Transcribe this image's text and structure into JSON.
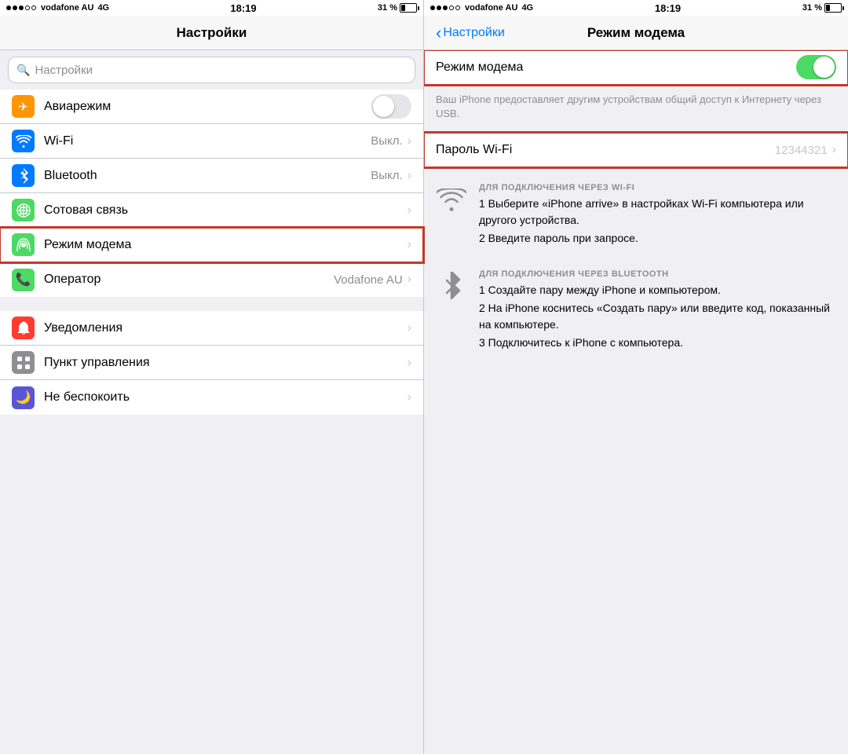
{
  "left": {
    "status_bar": {
      "carrier": "vodafone AU",
      "network": "4G",
      "time": "18:19",
      "battery_pct": "31 %"
    },
    "nav_title": "Настройки",
    "search_placeholder": "Настройки",
    "settings_items": [
      {
        "id": "airplane",
        "label": "Авиарежим",
        "value": "",
        "has_toggle": true,
        "toggle_on": false,
        "icon_bg": "#ff9500",
        "icon": "✈"
      },
      {
        "id": "wifi",
        "label": "Wi-Fi",
        "value": "Выкл.",
        "has_toggle": false,
        "icon_bg": "#007aff",
        "icon": "wifi"
      },
      {
        "id": "bluetooth",
        "label": "Bluetooth",
        "value": "Выкл.",
        "has_toggle": false,
        "icon_bg": "#007aff",
        "icon": "bt"
      },
      {
        "id": "cellular",
        "label": "Сотовая связь",
        "value": "",
        "has_toggle": false,
        "icon_bg": "#4cd964",
        "icon": "cellular"
      },
      {
        "id": "hotspot",
        "label": "Режим модема",
        "value": "",
        "has_toggle": false,
        "icon_bg": "#4cd964",
        "icon": "hotspot",
        "highlight": true
      },
      {
        "id": "operator",
        "label": "Оператор",
        "value": "Vodafone AU",
        "has_toggle": false,
        "icon_bg": "#4cd964",
        "icon": "phone"
      }
    ],
    "settings_items2": [
      {
        "id": "notifications",
        "label": "Уведомления",
        "value": "",
        "has_toggle": false,
        "icon_bg": "#ff3b30",
        "icon": "notif"
      },
      {
        "id": "control",
        "label": "Пункт управления",
        "value": "",
        "has_toggle": false,
        "icon_bg": "#8e8e93",
        "icon": "ctrl"
      },
      {
        "id": "dnd",
        "label": "Не беспокоить",
        "value": "",
        "has_toggle": false,
        "icon_bg": "#5856d6",
        "icon": "moon"
      }
    ]
  },
  "right": {
    "status_bar": {
      "carrier": "vodafone AU",
      "network": "4G",
      "time": "18:19",
      "battery_pct": "31 %"
    },
    "back_label": "Настройки",
    "nav_title": "Режим модема",
    "modem_toggle_label": "Режим модема",
    "modem_toggle_on": true,
    "info_text": "Ваш iPhone предоставляет другим устройствам общий доступ к Интернету через USB.",
    "password_label": "Пароль Wi-Fi",
    "password_value": "12344321",
    "wifi_section_title": "ДЛЯ ПОДКЛЮЧЕНИЯ ЧЕРЕЗ WI-FI",
    "wifi_step1": "1 Выберите «iPhone arrive» в настройках Wi-Fi компьютера или другого устройства.",
    "wifi_step2": "2 Введите пароль при запросе.",
    "bt_section_title": "ДЛЯ ПОДКЛЮЧЕНИЯ ЧЕРЕЗ BLUETOOTH",
    "bt_step1": "1 Создайте пару между iPhone и компьютером.",
    "bt_step2": "2 На iPhone коснитесь «Создать пару» или введите код, показанный на компьютере.",
    "bt_step3": "3 Подключитесь к iPhone с компьютера."
  }
}
